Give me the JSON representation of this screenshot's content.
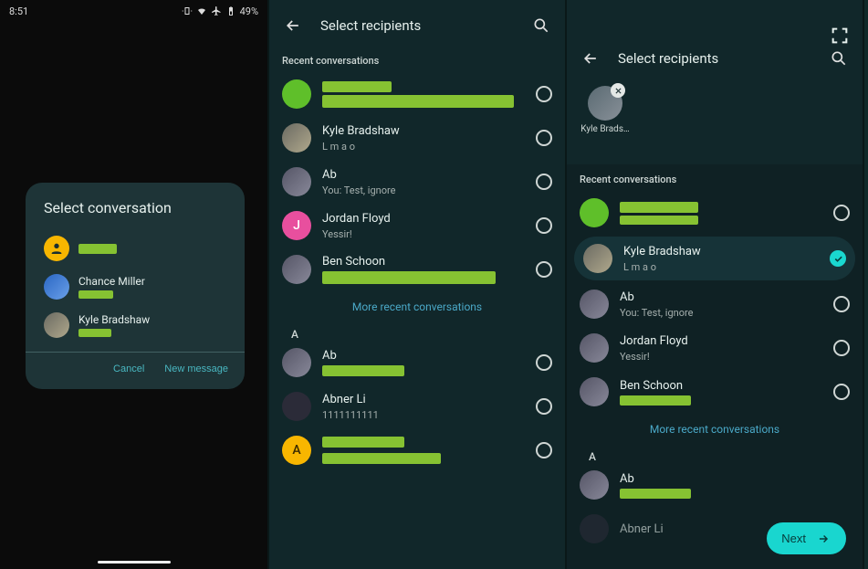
{
  "status": {
    "time": "8:51",
    "battery": "49%"
  },
  "dialog": {
    "title": "Select conversation",
    "items": [
      {
        "name": "",
        "redacted_name": true
      },
      {
        "name": "Chance Miller"
      },
      {
        "name": "Kyle Bradshaw"
      }
    ],
    "cancel": "Cancel",
    "new_message": "New message"
  },
  "picker": {
    "title": "Select recipients",
    "section_recent": "Recent conversations",
    "more_recent": "More recent conversations",
    "letter_a": "A",
    "recent": [
      {
        "name": "",
        "sub": "",
        "avatar": "green",
        "redacted": true
      },
      {
        "name": "Kyle Bradshaw",
        "sub": "L m a o",
        "avatar": "kyle"
      },
      {
        "name": "Ab",
        "sub": "You: Test, ignore",
        "avatar": "mix"
      },
      {
        "name": "Jordan Floyd",
        "sub": "Yessir!",
        "avatar": "pink",
        "letter": "J"
      },
      {
        "name": "Ben Schoon",
        "sub": "",
        "avatar": "mix",
        "redacted_sub": true
      }
    ],
    "alpha": [
      {
        "name": "Ab",
        "sub": "",
        "avatar": "mix",
        "redacted_sub": true
      },
      {
        "name": "Abner Li",
        "sub": "1111111111",
        "avatar": "dark"
      },
      {
        "name": "",
        "sub": "",
        "avatar": "amber",
        "letter": "A",
        "redacted": true
      }
    ]
  },
  "picker3": {
    "chip_name": "Kyle Brads…",
    "alpha": [
      {
        "name": "Ab",
        "redacted_sub": true
      },
      {
        "name": "Abner Li"
      }
    ],
    "next": "Next"
  }
}
